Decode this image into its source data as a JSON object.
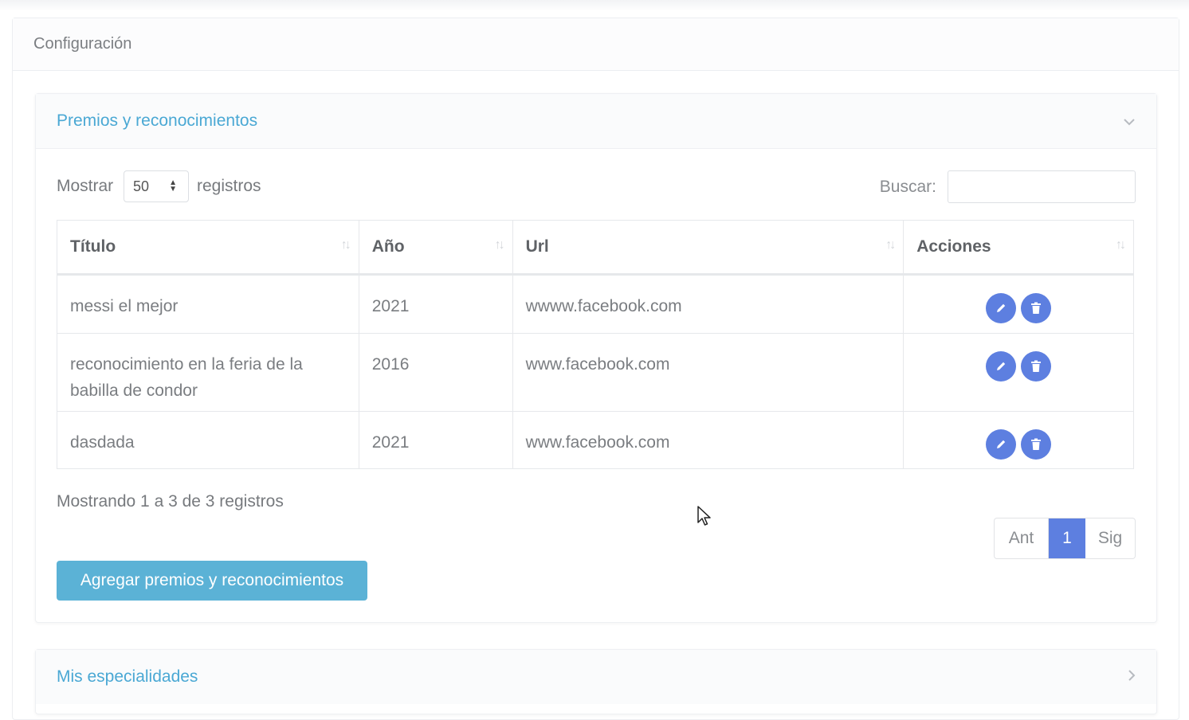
{
  "page": {
    "title": "Configuración"
  },
  "awards_panel": {
    "title": "Premios y reconocimientos",
    "show_label": "Mostrar",
    "page_size": "50",
    "records_label": "registros",
    "search_label": "Buscar:",
    "search_value": "",
    "columns": [
      "Título",
      "Año",
      "Url",
      "Acciones"
    ],
    "rows": [
      {
        "titulo": "messi el mejor",
        "anio": "2021",
        "url": "wwww.facebook.com"
      },
      {
        "titulo": "reconocimiento en la feria de la babilla de condor",
        "anio": "2016",
        "url": "www.facebook.com"
      },
      {
        "titulo": "dasdada",
        "anio": "2021",
        "url": "www.facebook.com"
      }
    ],
    "info_text": "Mostrando 1 a 3 de 3 registros",
    "pagination": {
      "prev": "Ant",
      "current": "1",
      "next": "Sig"
    },
    "add_button": "Agregar premios y reconocimientos"
  },
  "specialties_panel": {
    "title": "Mis especialidades"
  },
  "icons": {
    "edit": "pencil-icon",
    "delete": "trash-icon",
    "collapse": "chevron-down-icon",
    "expand": "chevron-right-icon",
    "sort": "sort-arrows-icon"
  },
  "colors": {
    "accent_blue": "#5d7fe0",
    "panel_title": "#4aa8d4",
    "add_button": "#5bb2d6"
  }
}
